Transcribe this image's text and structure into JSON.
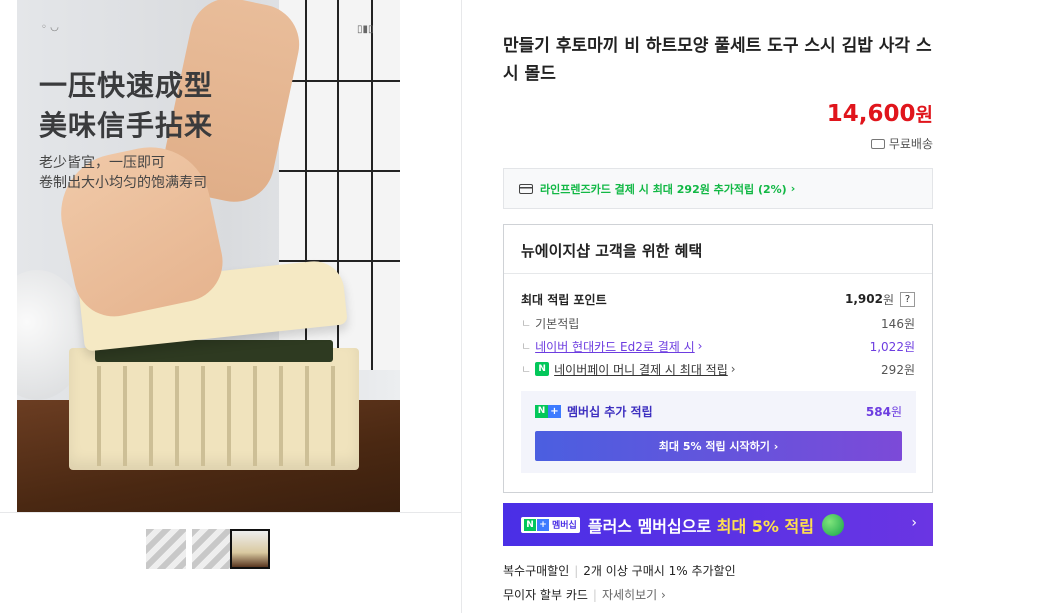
{
  "gallery": {
    "image_text": {
      "line1": "一压快速成型",
      "line2": "美味信手拈来",
      "line3": "老少皆宜，一压即可",
      "line4": "卷制出大小均匀的饱满寿司"
    },
    "thumbnail_count": 3,
    "active_thumbnail": 3
  },
  "product": {
    "title": "만들기 후토마끼 비 하트모양 풀세트 도구 스시 김밥 사각 스시 몰드",
    "price": "14,600",
    "price_unit": "원",
    "shipping": "무료배송"
  },
  "card_promo": {
    "text": "라인프렌즈카드 결제 시 최대 292원 추가적립 (2%)",
    "arrow": "›"
  },
  "benefits": {
    "heading": "뉴에이지샵 고객을 위한 혜택",
    "max_points_label": "최대 적립 포인트",
    "max_points_value": "1,902",
    "max_points_unit": "원",
    "help": "?",
    "items": [
      {
        "label": "기본적립",
        "value": "146원"
      },
      {
        "label": "네이버 현대카드 Ed2로 결제 시",
        "value": "1,022원"
      },
      {
        "label": "네이버페이 머니 결제 시 최대 적립",
        "value": "292원"
      }
    ],
    "tick": "ㄴ",
    "chevron": "›",
    "member": {
      "label": "멤버십 추가 적립",
      "value": "584",
      "unit": "원",
      "button": "최대 5% 적립 시작하기 ›"
    }
  },
  "banner": {
    "badge_text": "멤버십",
    "text_plain": "플러스 멤버십으로 ",
    "text_highlight": "최대 5% 적립",
    "arrow": "›"
  },
  "extras": {
    "multi_label": "복수구매할인",
    "multi_value": "2개 이상 구매시 1% 추가할인",
    "card_label": "무이자 할부 카드",
    "card_link": "자세히보기 ›"
  },
  "colors": {
    "price": "#e0151c",
    "promo_green": "#12b845",
    "banner": "#4a2fe6",
    "link_purple": "#6d3de0"
  }
}
